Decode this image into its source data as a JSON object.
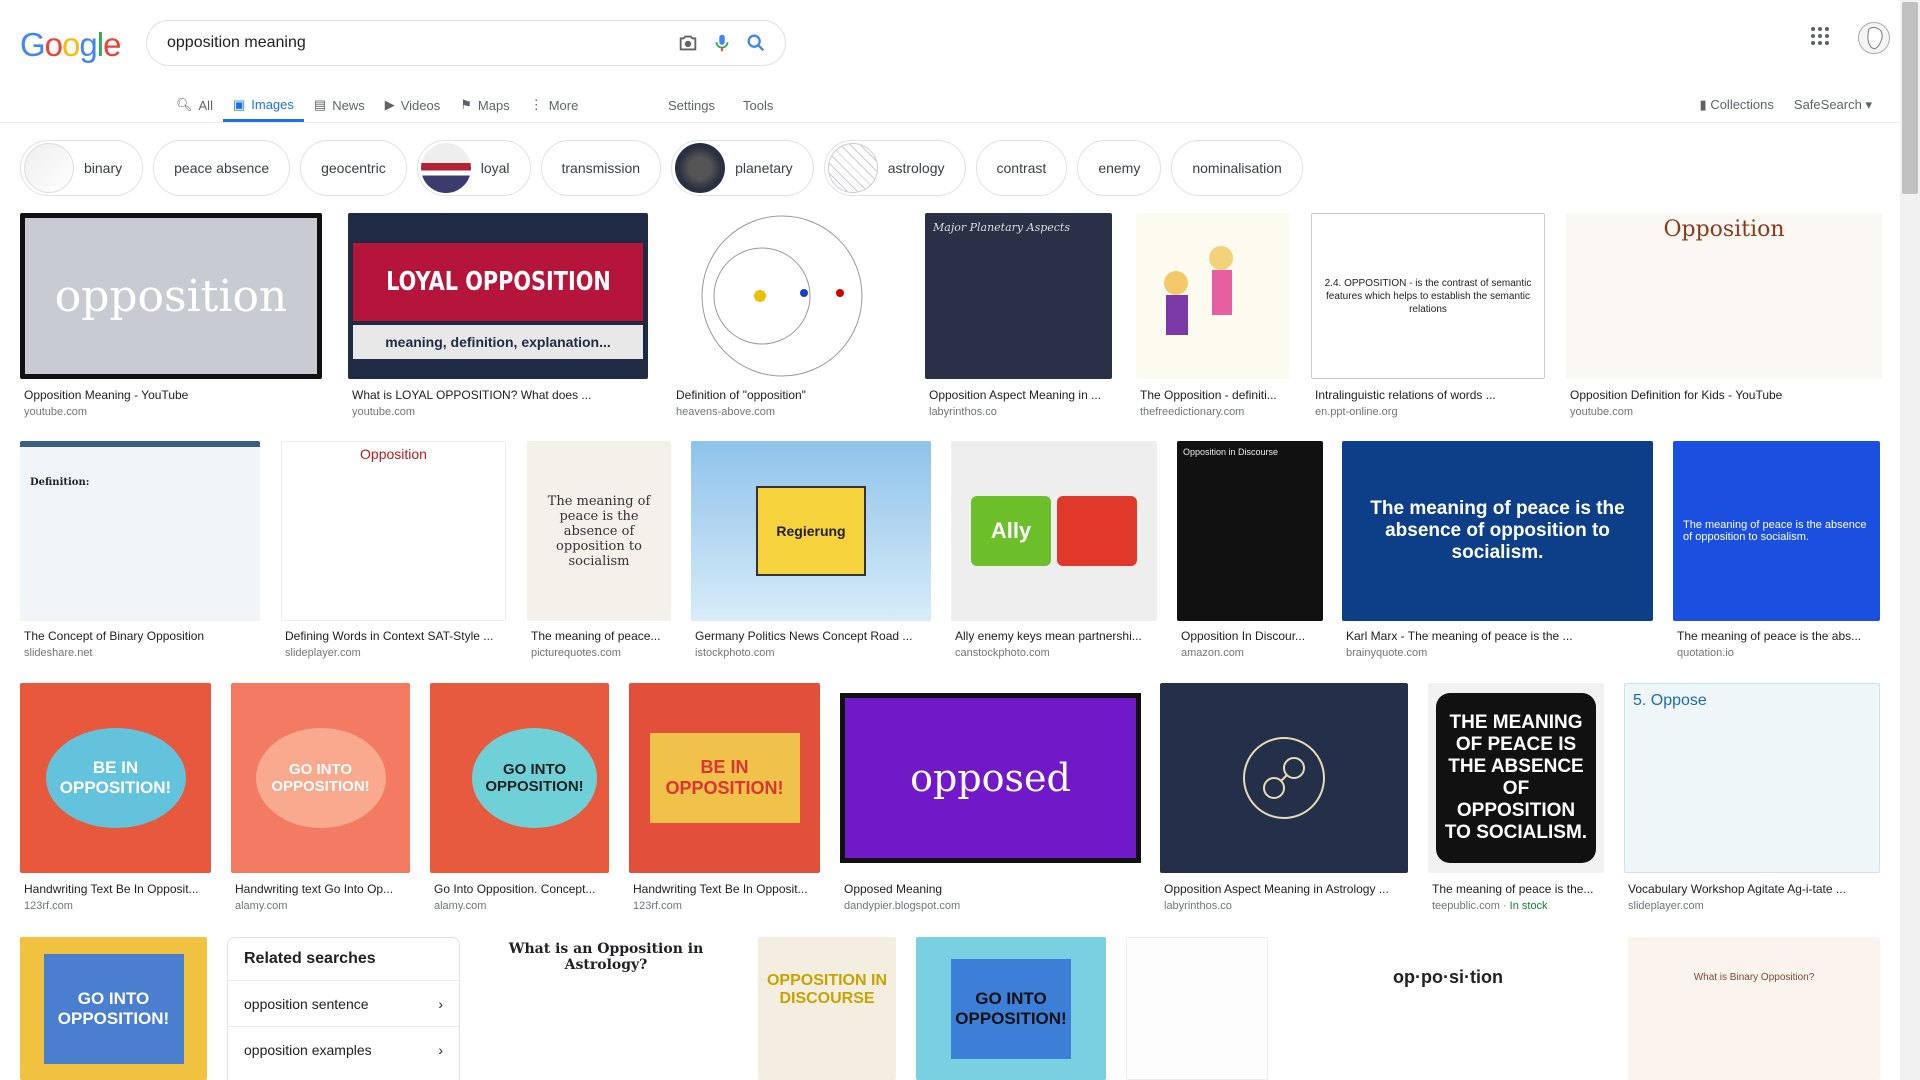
{
  "logo": {
    "letters": [
      "G",
      "o",
      "o",
      "g",
      "l",
      "e"
    ]
  },
  "search": {
    "query": "opposition meaning",
    "camera_icon": "camera-icon",
    "mic_icon": "mic-icon",
    "search_icon": "search-icon"
  },
  "tabs": [
    {
      "label": "All",
      "icon": "search-icon",
      "active": false
    },
    {
      "label": "Images",
      "icon": "image-icon",
      "active": true
    },
    {
      "label": "News",
      "icon": "news-icon",
      "active": false
    },
    {
      "label": "Videos",
      "icon": "video-icon",
      "active": false
    },
    {
      "label": "Maps",
      "icon": "map-icon",
      "active": false
    },
    {
      "label": "More",
      "icon": "more-icon",
      "active": false
    }
  ],
  "tools": {
    "settings": "Settings",
    "tools": "Tools"
  },
  "right_tools": {
    "collections": "Collections",
    "safesearch": "SafeSearch"
  },
  "chips": [
    "binary",
    "peace absence",
    "geocentric",
    "loyal",
    "transmission",
    "planetary",
    "astrology",
    "contrast",
    "enemy",
    "nominalisation"
  ],
  "row1": [
    {
      "title": "Opposition Meaning - YouTube",
      "source": "youtube.com",
      "img_text": "opposition"
    },
    {
      "title": "What is LOYAL OPPOSITION? What does ...",
      "source": "youtube.com",
      "img_text": "LOYAL OPPOSITION",
      "img_sub": "meaning, definition, explanation..."
    },
    {
      "title": "Definition of \"opposition\"",
      "source": "heavens-above.com",
      "img_text": ""
    },
    {
      "title": "Opposition Aspect Meaning in ...",
      "source": "labyrinthos.co",
      "img_text": "Major Planetary Aspects"
    },
    {
      "title": "The Opposition - definiti...",
      "source": "thefreedictionary.com",
      "img_text": ""
    },
    {
      "title": "Intralinguistic relations of words ...",
      "source": "en.ppt-online.org",
      "img_text": "2.4. OPPOSITION - is the contrast of semantic features which helps to establish the semantic relations"
    },
    {
      "title": "Opposition Definition for Kids - YouTube",
      "source": "youtube.com",
      "img_text": "Opposition"
    }
  ],
  "row2": [
    {
      "title": "The Concept of Binary Opposition",
      "source": "slideshare.net",
      "img_text": "Definition:"
    },
    {
      "title": "Defining Words in Context SAT-Style ...",
      "source": "slideplayer.com",
      "img_text": "Opposition"
    },
    {
      "title": "The meaning of peace...",
      "source": "picturequotes.com",
      "img_text": "The meaning of peace is the absence of opposition to socialism"
    },
    {
      "title": "Germany Politics News Concept Road ...",
      "source": "istockphoto.com",
      "img_text": "Regierung"
    },
    {
      "title": "Ally enemy keys mean partnershi...",
      "source": "canstockphoto.com",
      "img_text": "Ally"
    },
    {
      "title": "Opposition In Discour...",
      "source": "amazon.com",
      "img_text": "Opposition in Discourse"
    },
    {
      "title": "Karl Marx - The meaning of peace is the ...",
      "source": "brainyquote.com",
      "img_text": "The meaning of peace is the absence of opposition to socialism."
    },
    {
      "title": "The meaning of peace is the abs...",
      "source": "quotation.io",
      "img_text": "The meaning of peace is the absence of opposition to socialism."
    }
  ],
  "row3": [
    {
      "title": "Handwriting Text Be In Opposit...",
      "source": "123rf.com",
      "img_text": "BE IN OPPOSITION!"
    },
    {
      "title": "Handwriting text Go Into Op...",
      "source": "alamy.com",
      "img_text": "GO INTO OPPOSITION!"
    },
    {
      "title": "Go Into Opposition. Concept...",
      "source": "alamy.com",
      "img_text": "GO INTO OPPOSITION!"
    },
    {
      "title": "Handwriting Text Be In Opposit...",
      "source": "123rf.com",
      "img_text": "BE IN OPPOSITION!"
    },
    {
      "title": "Opposed Meaning",
      "source": "dandypier.blogspot.com",
      "img_text": "opposed"
    },
    {
      "title": "Opposition Aspect Meaning in Astrology ...",
      "source": "labyrinthos.co",
      "img_text": ""
    },
    {
      "title": "The meaning of peace is the...",
      "source": "teepublic.com",
      "source_extra": "In stock",
      "img_text": "THE MEANING OF PEACE IS THE ABSENCE OF OPPOSITION TO SOCIALISM."
    },
    {
      "title": "Vocabulary Workshop Agitate Ag-i-tate ...",
      "source": "slideplayer.com",
      "img_text": "5. Oppose"
    }
  ],
  "related": {
    "heading": "Related searches",
    "items": [
      "opposition sentence",
      "opposition examples"
    ]
  },
  "row4": [
    {
      "img_text": "GO INTO OPPOSITION!"
    },
    {
      "img_text": "What is an Opposition in Astrology?"
    },
    {
      "img_text": "OPPOSITION IN DISCOURSE"
    },
    {
      "img_text": "GO INTO OPPOSITION!"
    },
    {
      "img_text": ""
    },
    {
      "img_text": "op·po·si·tion"
    },
    {
      "img_text": "What is Binary Opposition?"
    }
  ]
}
